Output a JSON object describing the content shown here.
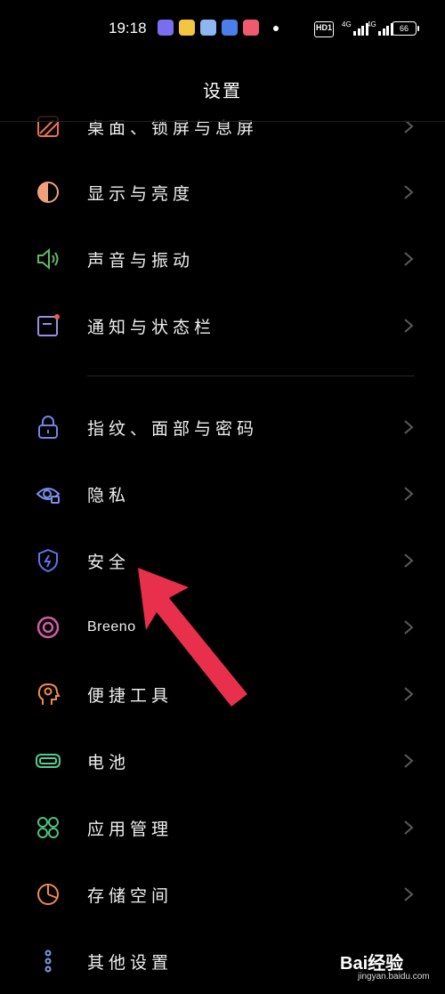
{
  "status_bar": {
    "time": "19:18",
    "hd_label": "HD1",
    "signal_1_label": "4G",
    "signal_2_label": "4G",
    "battery": "66"
  },
  "header": {
    "title": "设置"
  },
  "settings": {
    "items": [
      {
        "label": "桌面、锁屏与息屏",
        "icon": "wallpaper-icon",
        "color": "#e8734a"
      },
      {
        "label": "显示与亮度",
        "icon": "display-icon",
        "color": "#f0a07a"
      },
      {
        "label": "声音与振动",
        "icon": "speaker-icon",
        "color": "#5dbb63"
      },
      {
        "label": "通知与状态栏",
        "icon": "notification-icon",
        "color": "#9c8fe0"
      },
      {
        "label": "指纹、面部与密码",
        "icon": "lock-icon",
        "color": "#6f86e8"
      },
      {
        "label": "隐私",
        "icon": "privacy-eye-icon",
        "color": "#7a8ff0"
      },
      {
        "label": "安全",
        "icon": "shield-icon",
        "color": "#5b74e6"
      },
      {
        "label": "Breeno",
        "icon": "breeno-icon",
        "color": "#d05ca6"
      },
      {
        "label": "便捷工具",
        "icon": "tools-head-icon",
        "color": "#f08a4b"
      },
      {
        "label": "电池",
        "icon": "battery-icon",
        "color": "#4fcf8f"
      },
      {
        "label": "应用管理",
        "icon": "apps-icon",
        "color": "#4fc27a"
      },
      {
        "label": "存储空间",
        "icon": "storage-pie-icon",
        "color": "#f08a4b"
      },
      {
        "label": "其他设置",
        "icon": "more-icon",
        "color": "#7a9ae0"
      }
    ]
  },
  "watermark": {
    "main": "Bai经验",
    "sub": "jingyan.baidu.com"
  },
  "colors": {
    "background": "#000000",
    "arrow": "#e8304c",
    "chevron": "#5a5a5a"
  }
}
